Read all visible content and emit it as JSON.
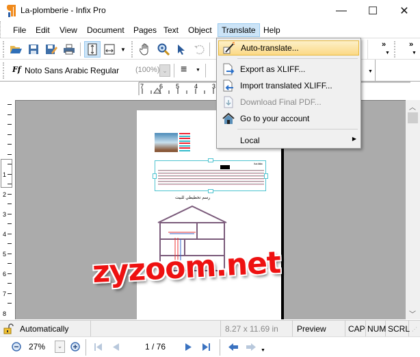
{
  "window": {
    "title": "La-plomberie - Infix Pro",
    "minimize_glyph": "—",
    "maximize_glyph": "☐",
    "close_glyph": "✕"
  },
  "menubar": {
    "items": [
      {
        "label": "File"
      },
      {
        "label": "Edit"
      },
      {
        "label": "View"
      },
      {
        "label": "Document"
      },
      {
        "label": "Pages"
      },
      {
        "label": "Text"
      },
      {
        "label": "Object"
      },
      {
        "label": "Translate",
        "active": true
      },
      {
        "label": "Help"
      }
    ]
  },
  "toolbar1": {
    "icons": [
      "open-folder-icon",
      "save-icon",
      "save-as-icon",
      "print-icon",
      "fit-page-icon",
      "fit-width-icon",
      "hand-tool-icon",
      "zoom-tool-icon",
      "select-arrow-icon",
      "undo-icon"
    ],
    "overflow": "»"
  },
  "toolbar2": {
    "font_icon_label": "Ff",
    "font_name": "Noto Sans Arabic Regular",
    "font_scale": "(100%)",
    "align_icon": "≡"
  },
  "ruler": {
    "h_ticks": [
      "7",
      "6",
      "5",
      "4",
      "3"
    ],
    "v_ticks": [
      "1",
      "2",
      "3",
      "4",
      "5",
      "6",
      "7",
      "8"
    ]
  },
  "translate_menu": {
    "items": [
      {
        "label": "Auto-translate...",
        "icon": "magic-wand-icon",
        "highlighted": true
      },
      {
        "label": "Export as XLIFF...",
        "icon": "export-xliff-icon"
      },
      {
        "label": "Import translated XLIFF...",
        "icon": "import-xliff-icon"
      },
      {
        "label": "Download Final PDF...",
        "icon": "download-pdf-icon",
        "disabled": true
      },
      {
        "label": "Go to your account",
        "icon": "home-icon"
      },
      {
        "label": "Local",
        "icon": "",
        "submenu": true
      }
    ]
  },
  "document": {
    "caption": "رسم تخطيطي للبيت",
    "heading": "مقدمة"
  },
  "statusbar": {
    "message": "Automatically transl",
    "page_size": "8.27 x 11.69 in",
    "mode": "Preview",
    "cap": "CAP",
    "num": "NUM",
    "scrl": "SCRL"
  },
  "navbar": {
    "zoom": "27%",
    "page": "1 / 76"
  },
  "watermark": "zyzoom.net"
}
